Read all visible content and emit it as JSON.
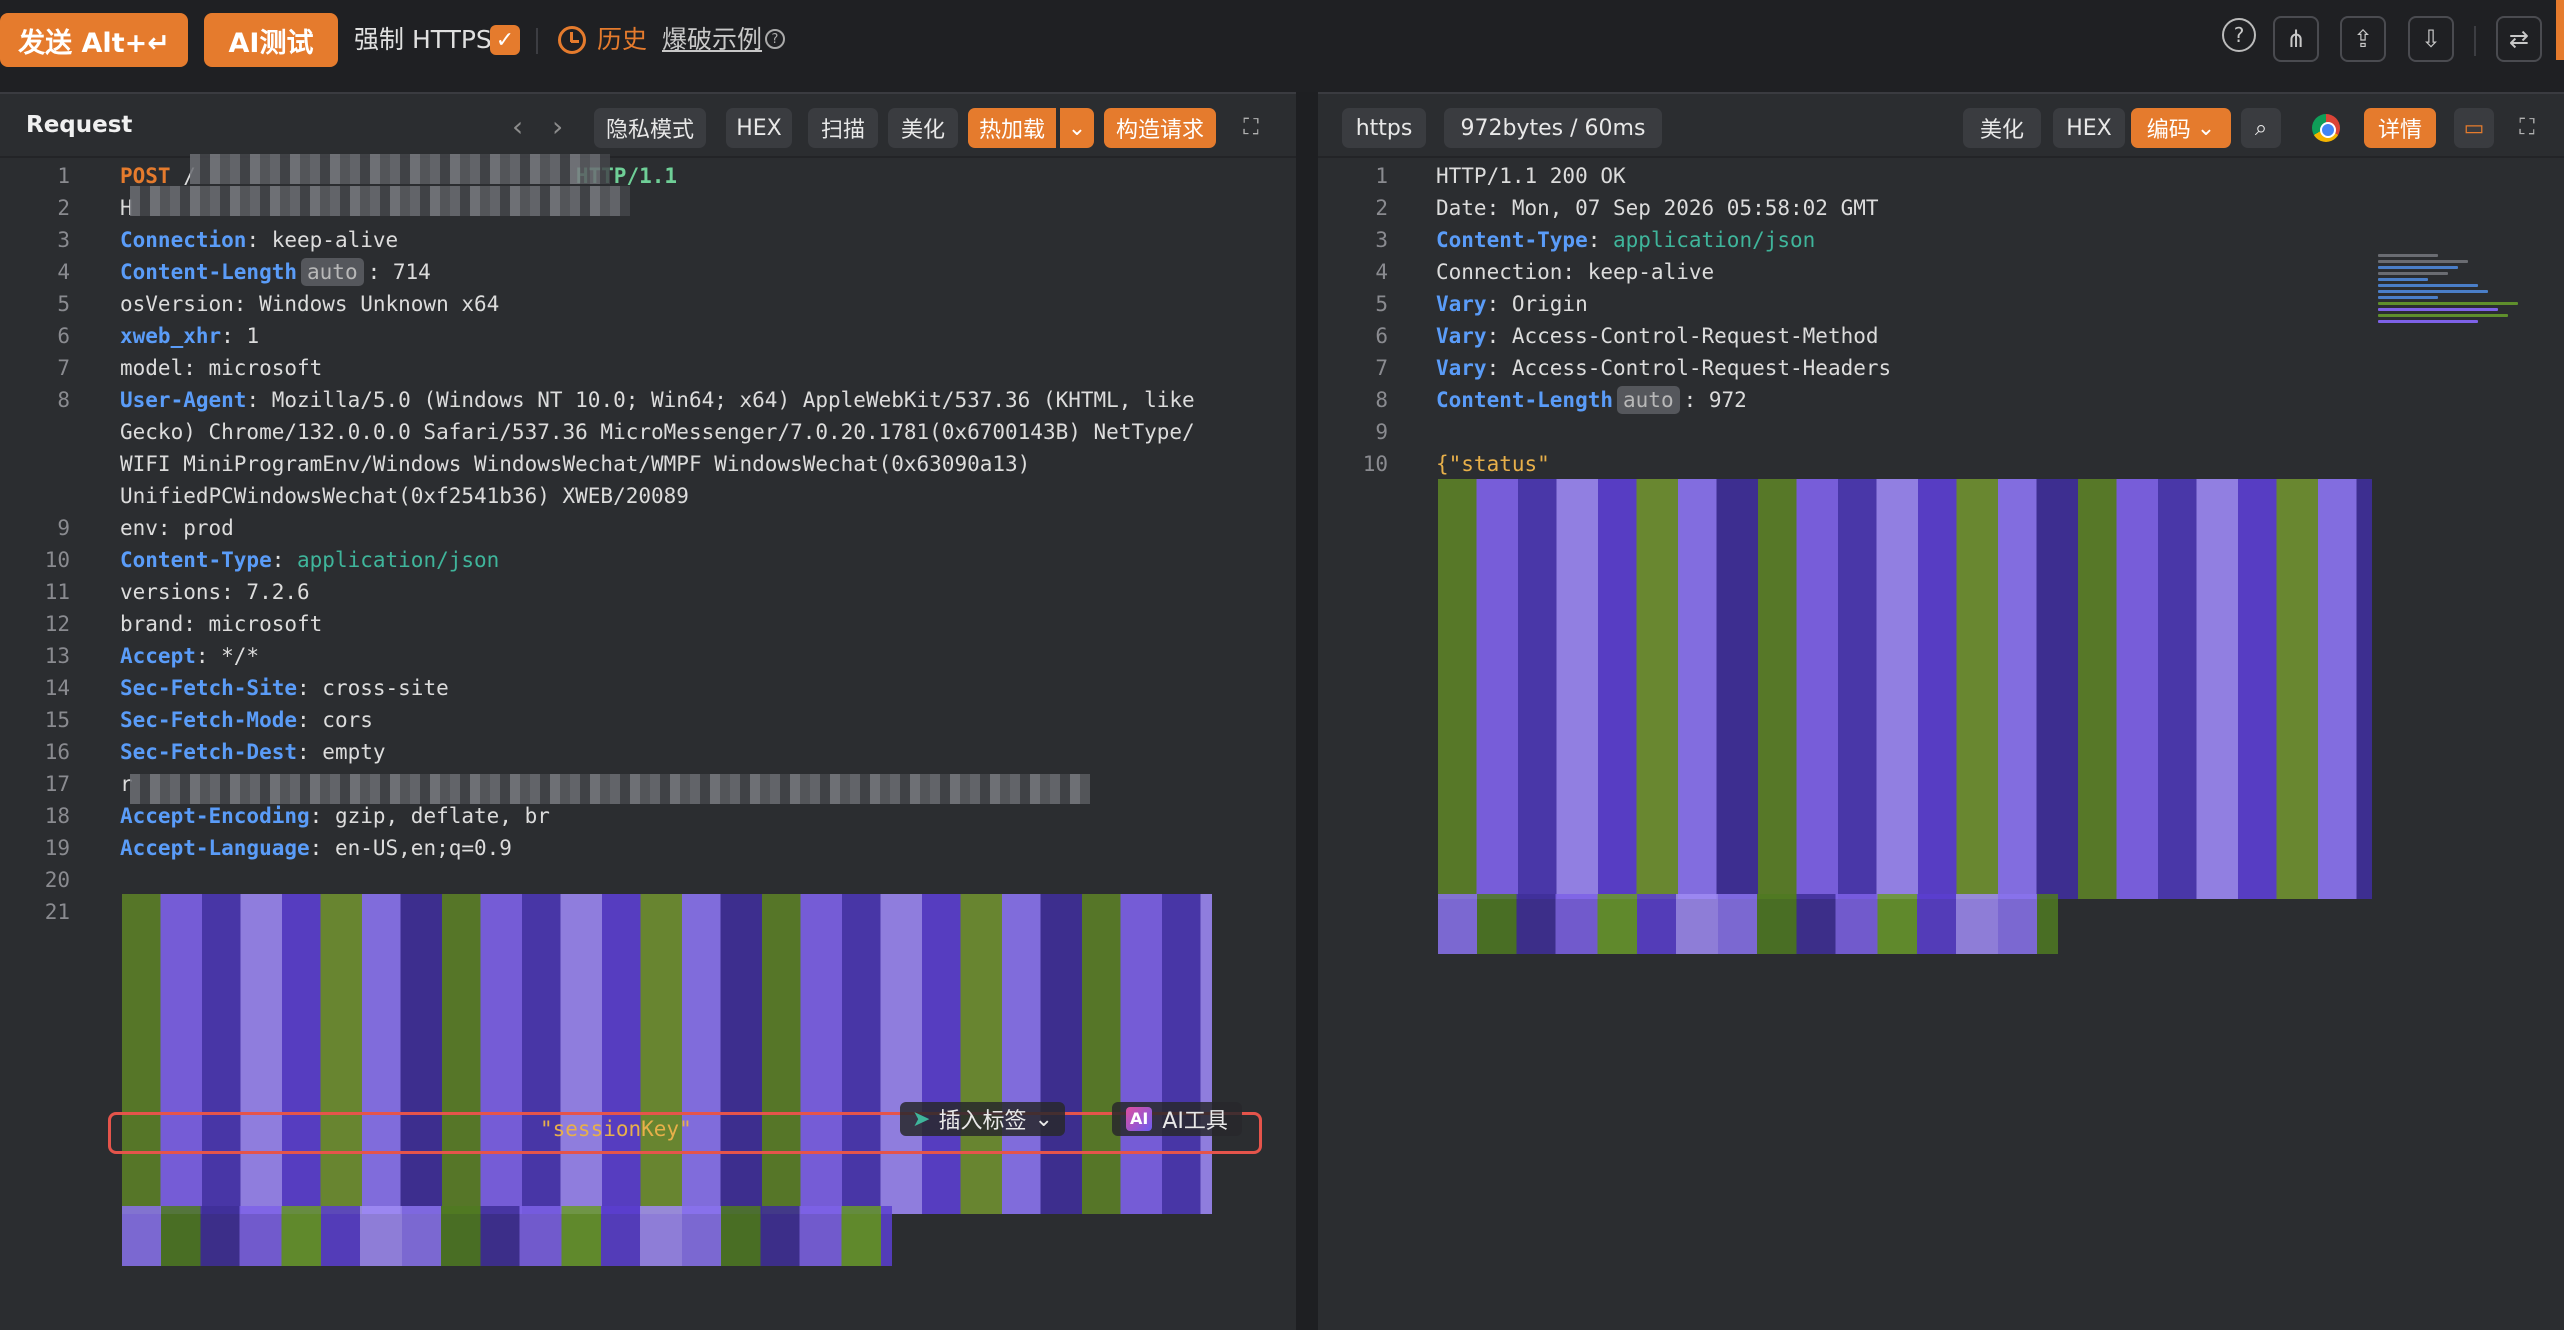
{
  "toolbar": {
    "send_label": "发送 Alt+↵",
    "ai_test_label": "AI测试",
    "force_https_label": "强制 HTTPS",
    "force_https_checked": true,
    "history_label": "历史",
    "examples_label": "爆破示例",
    "accent_color": "#e57b2d"
  },
  "request": {
    "title": "Request",
    "buttons": {
      "privacy": "隐私模式",
      "hex": "HEX",
      "scan": "扫描",
      "beautify": "美化",
      "hotload": "热加载",
      "build": "构造请求"
    },
    "lines": [
      {
        "n": "1",
        "method": "POST",
        "rest": " /",
        "version": "HTTP/1.1"
      },
      {
        "n": "2",
        "text": "H"
      },
      {
        "n": "3",
        "key": "Connection",
        "value": ": keep-alive"
      },
      {
        "n": "4",
        "key": "Content-Length",
        "badge": "auto",
        "value": ": 714"
      },
      {
        "n": "5",
        "text": "osVersion: Windows Unknown x64"
      },
      {
        "n": "6",
        "key": "xweb_xhr",
        "value": ": 1"
      },
      {
        "n": "7",
        "text": "model: microsoft"
      },
      {
        "n": "8",
        "key": "User-Agent",
        "value": ": Mozilla/5.0 (Windows NT 10.0; Win64; x64) AppleWebKit/537.36 (KHTML, like"
      },
      {
        "n": "",
        "text": "Gecko) Chrome/132.0.0.0 Safari/537.36 MicroMessenger/7.0.20.1781(0x6700143B) NetType/"
      },
      {
        "n": "",
        "text": "WIFI MiniProgramEnv/Windows WindowsWechat/WMPF WindowsWechat(0x63090a13)"
      },
      {
        "n": "",
        "text": "UnifiedPCWindowsWechat(0xf2541b36) XWEB/20089"
      },
      {
        "n": "9",
        "text": "env: prod"
      },
      {
        "n": "10",
        "key": "Content-Type",
        "mime": "application/json"
      },
      {
        "n": "11",
        "text": "versions: 7.2.6"
      },
      {
        "n": "12",
        "text": "brand: microsoft"
      },
      {
        "n": "13",
        "key": "Accept",
        "value": ": */*"
      },
      {
        "n": "14",
        "key": "Sec-Fetch-Site",
        "value": ": cross-site"
      },
      {
        "n": "15",
        "key": "Sec-Fetch-Mode",
        "value": ": cors"
      },
      {
        "n": "16",
        "key": "Sec-Fetch-Dest",
        "value": ": empty"
      },
      {
        "n": "17",
        "text": "r"
      },
      {
        "n": "18",
        "key": "Accept-Encoding",
        "value": ": gzip, deflate, br"
      },
      {
        "n": "19",
        "key": "Accept-Language",
        "value": ": en-US,en;q=0.9"
      },
      {
        "n": "20",
        "text": ""
      },
      {
        "n": "21",
        "text": ""
      }
    ],
    "selected_fragment_key": "\"sessionKey\"",
    "popup": {
      "insert_tag": "插入标签",
      "ai_tool": "AI工具"
    }
  },
  "response": {
    "scheme": "https",
    "size_time": "972bytes / 60ms",
    "buttons": {
      "beautify": "美化",
      "hex": "HEX",
      "encoding": "编码",
      "details": "详情"
    },
    "lines": [
      {
        "n": "1",
        "text": "HTTP/1.1 200 OK"
      },
      {
        "n": "2",
        "text": "Date: Mon, 07 Sep 2026 05:58:02 GMT"
      },
      {
        "n": "3",
        "key": "Content-Type",
        "mime": "application/json"
      },
      {
        "n": "4",
        "text": "Connection: keep-alive"
      },
      {
        "n": "5",
        "key": "Vary",
        "value": ": Origin"
      },
      {
        "n": "6",
        "key": "Vary",
        "value": ": Access-Control-Request-Method"
      },
      {
        "n": "7",
        "key": "Vary",
        "value": ": Access-Control-Request-Headers"
      },
      {
        "n": "8",
        "key": "Content-Length",
        "badge": "auto",
        "value": ": 972"
      },
      {
        "n": "9",
        "text": ""
      },
      {
        "n": "10",
        "json_key": "{\"status\"",
        "text": ""
      }
    ]
  }
}
